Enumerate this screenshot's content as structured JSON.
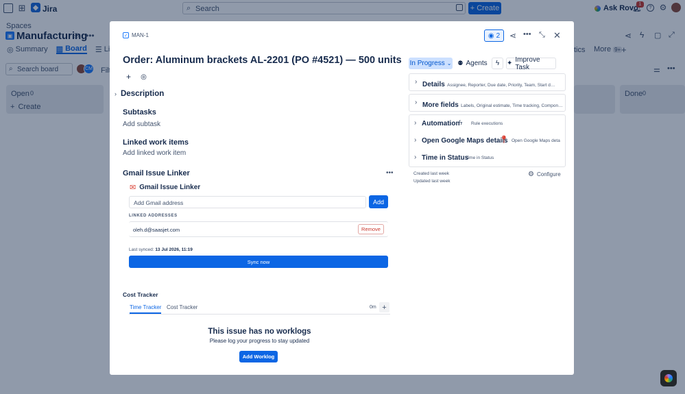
{
  "topbar": {
    "app_name": "Jira",
    "search_placeholder": "Search",
    "create_label": "Create",
    "ask_rovo_label": "Ask Rovo",
    "notifications_count": "1"
  },
  "project": {
    "spaces_label": "Spaces",
    "name": "Manufacturing",
    "tabs": [
      {
        "label": "Summary"
      },
      {
        "label": "Board"
      },
      {
        "label": "List"
      }
    ],
    "tab_tail": "tics",
    "more_label": "More",
    "more_count": "9+",
    "search_board_placeholder": "Search board",
    "filter_label": "Filte",
    "avatar_initials": "CM",
    "columns": [
      {
        "name": "Open",
        "count": "0"
      },
      {
        "name": "Done",
        "count": "0"
      }
    ],
    "create_label": "Create"
  },
  "issue": {
    "key": "MAN-1",
    "watchers": "2",
    "title": "Order: Aluminum brackets AL-2201 (PO #4521) — 500 units",
    "status": "In Progress",
    "agents_label": "Agents",
    "improve_label": "Improve Task",
    "description_label": "Description",
    "subtasks_label": "Subtasks",
    "add_subtask": "Add subtask",
    "linked_label": "Linked work items",
    "add_linked": "Add linked work item"
  },
  "panels": [
    {
      "title": "Details",
      "sub": "Assignee, Reporter, Due date, Priority, Team, Start d…"
    },
    {
      "title": "More fields",
      "sub": "Labels, Original estimate, Time tracking, Compon…"
    },
    {
      "title": "Automation",
      "sub": "Rule executions"
    },
    {
      "title": "Open Google Maps details",
      "sub": "Open Google Maps deta"
    },
    {
      "title": "Time in Status",
      "sub": "Time in Status"
    }
  ],
  "meta": {
    "created": "Created last week",
    "updated": "Updated last week",
    "configure": "Configure"
  },
  "gmail": {
    "section_title": "Gmail Issue Linker",
    "app_title": "Gmail Issue Linker",
    "input_placeholder": "Add Gmail address",
    "add_label": "Add",
    "linked_header": "LINKED ADDRESSES",
    "address": "oleh.d@saasjet.com",
    "remove_label": "Remove",
    "last_synced_prefix": "Last synced:",
    "last_synced_value": "13 Jul 2026, 11:19",
    "sync_label": "Sync now"
  },
  "cost": {
    "section_title": "Cost Tracker",
    "tabs": [
      {
        "label": "Time Tracker"
      },
      {
        "label": "Cost Tracker"
      }
    ],
    "time_value": "0m",
    "empty_title": "This issue has no worklogs",
    "empty_sub": "Please log your progress to stay updated",
    "add_worklog": "Add Worklog"
  },
  "colors": {
    "accent": "#0c66e4",
    "status_bg": "#cce0ff",
    "danger": "#c9372c",
    "gmail_red": "#db4437"
  }
}
